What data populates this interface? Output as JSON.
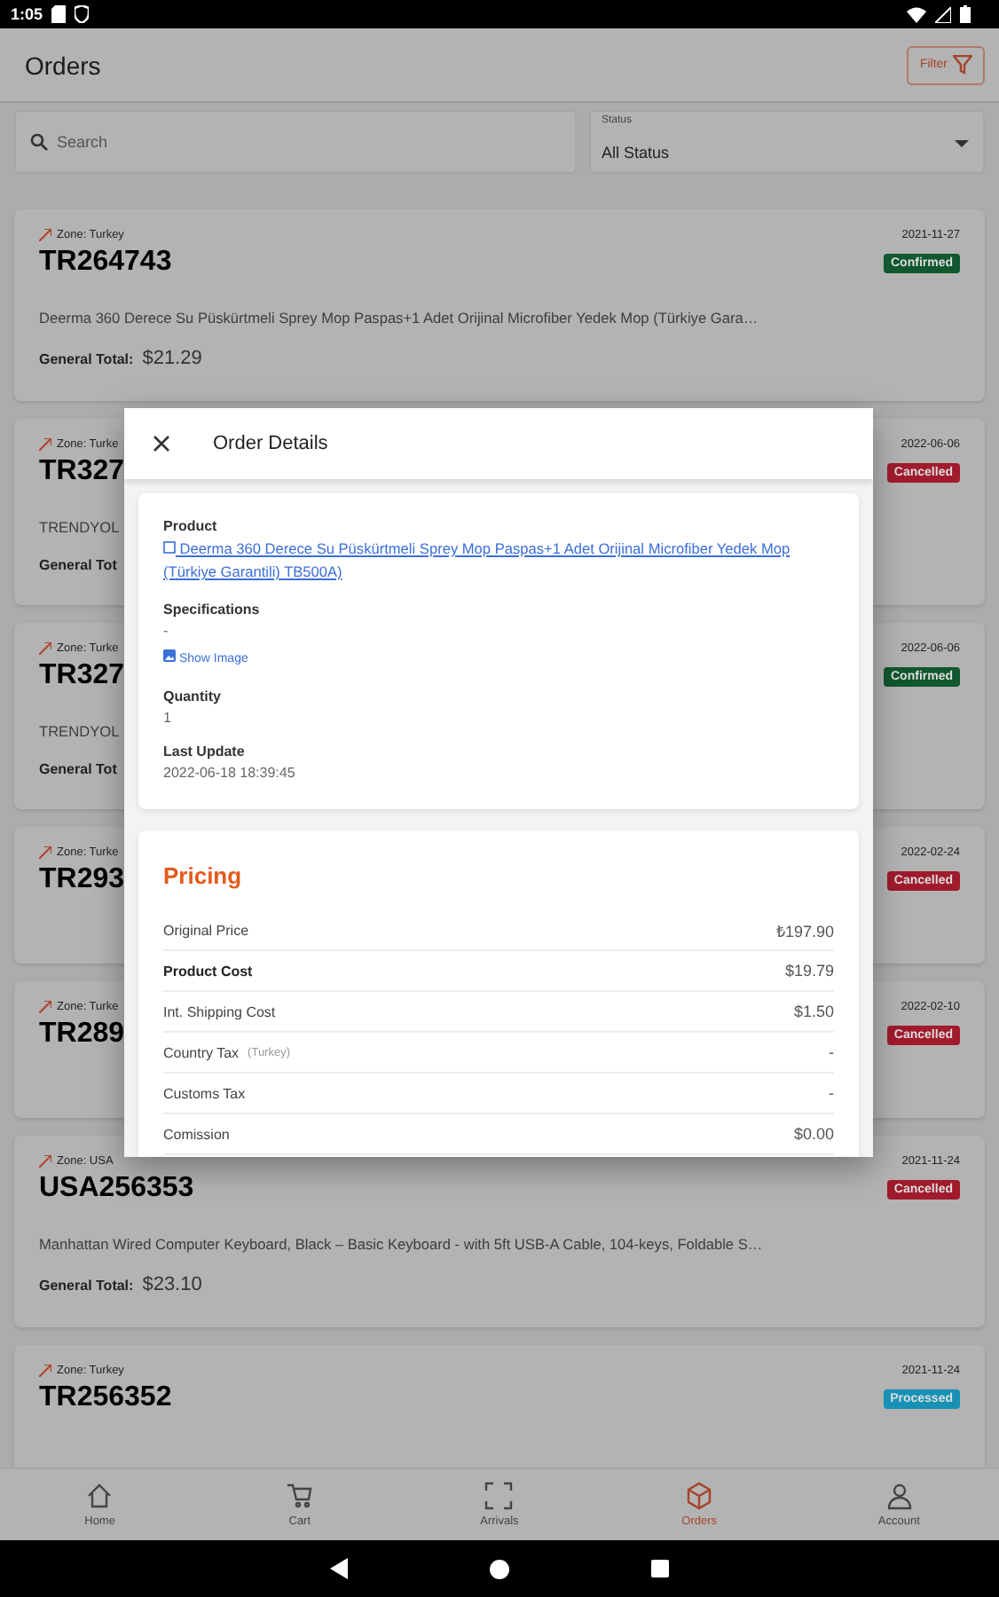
{
  "status_bar": {
    "time": "1:05"
  },
  "app_bar": {
    "title": "Orders",
    "filter_button": "Filter"
  },
  "search": {
    "placeholder": "Search"
  },
  "status_select": {
    "label": "Status",
    "value": "All Status"
  },
  "orders": [
    {
      "zone": "Zone: Turkey",
      "id": "TR264743",
      "date": "2021-11-27",
      "status": "Confirmed",
      "color": "#11572f",
      "description": "Deerma 360 Derece Su Püskürtmeli Sprey Mop Paspas+1 Adet Orijinal Microfiber Yedek Mop (Türkiye Gara…",
      "total_label": "General Total:",
      "total": "$21.29"
    },
    {
      "zone": "Zone: Turke",
      "id": "TR327",
      "date": "2022-06-06",
      "status": "Cancelled",
      "color": "#a01b2c",
      "description": "TRENDYOL",
      "total_label": "General Tot"
    },
    {
      "zone": "Zone: Turke",
      "id": "TR327",
      "date": "2022-06-06",
      "status": "Confirmed",
      "color": "#11572f",
      "description": "TRENDYOL",
      "total_label": "General Tot"
    },
    {
      "zone": "Zone: Turke",
      "id": "TR293",
      "date": "2022-02-24",
      "status": "Cancelled",
      "color": "#a01b2c"
    },
    {
      "zone": "Zone: Turke",
      "id": "TR289",
      "date": "2022-02-10",
      "status": "Cancelled",
      "color": "#a01b2c"
    },
    {
      "zone": "Zone: USA",
      "id": "USA256353",
      "date": "2021-11-24",
      "status": "Cancelled",
      "color": "#a01b2c",
      "description": "Manhattan Wired Computer Keyboard, Black – Basic Keyboard - with 5ft USB-A Cable, 104-keys, Foldable S…",
      "total_label": "General Total:",
      "total": "$23.10"
    },
    {
      "zone": "Zone: Turkey",
      "id": "TR256352",
      "date": "2021-11-24",
      "status": "Processed",
      "color": "#1792b6"
    }
  ],
  "nav": [
    {
      "label": "Home",
      "selected": false
    },
    {
      "label": "Cart",
      "selected": false
    },
    {
      "label": "Arrivals",
      "selected": false
    },
    {
      "label": "Orders",
      "selected": true
    },
    {
      "label": "Account",
      "selected": false
    }
  ],
  "dialog": {
    "title": "Order Details",
    "product_label": "Product",
    "product_link": "Deerma 360 Derece Su Püskürtmeli Sprey Mop Paspas+1 Adet Orijinal Microfiber Yedek Mop (Türkiye Garantili) TB500A)",
    "specifications_label": "Specifications",
    "specifications": "-",
    "show_image": "Show Image",
    "quantity_label": "Quantity",
    "quantity": "1",
    "last_update_label": "Last Update",
    "last_update": "2022-06-18 18:39:45",
    "pricing_title": "Pricing",
    "pricing": [
      {
        "label": "Original Price",
        "value": "₺197.90",
        "emphasis": false
      },
      {
        "label": "Product Cost",
        "value": "$19.79",
        "emphasis": true
      },
      {
        "label": "Int. Shipping Cost",
        "value": "$1.50",
        "emphasis": false
      },
      {
        "label": "Country Tax",
        "note": "(Turkey)",
        "value": "-",
        "emphasis": false
      },
      {
        "label": "Customs Tax",
        "value": "-",
        "emphasis": false
      },
      {
        "label": "Comission",
        "value": "$0.00",
        "emphasis": false
      }
    ]
  }
}
